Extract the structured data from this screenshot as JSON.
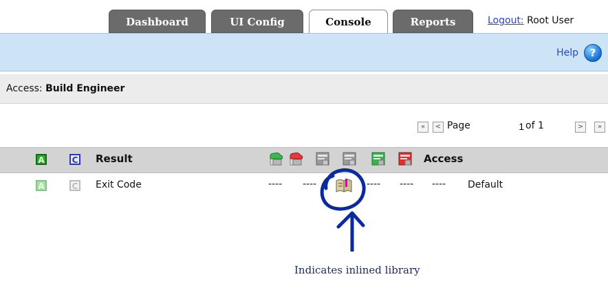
{
  "tabs": [
    {
      "label": "Dashboard"
    },
    {
      "label": "UI Config"
    },
    {
      "label": "Console"
    },
    {
      "label": "Reports"
    }
  ],
  "user": {
    "logout_label": "Logout:",
    "name": "Root User"
  },
  "help_label": "Help",
  "help_icon": "?",
  "access": {
    "prefix": "Access:",
    "role": "Build Engineer"
  },
  "pager": {
    "first_icon": "«",
    "prev_icon": "<",
    "next_icon": ">",
    "last_icon": "»",
    "page_label": "Page",
    "page_value": "1",
    "of_label": "of 1"
  },
  "table": {
    "letters": [
      "A",
      "C"
    ],
    "result_header": "Result",
    "access_header": "Access",
    "header_icons": [
      "green-cloud-icon",
      "red-cloud-icon",
      "gray-form-icon",
      "gray-form-icon",
      "green-form-icon",
      "red-form-icon"
    ],
    "row": {
      "letters": [
        "A",
        "C"
      ],
      "name": "Exit Code",
      "cells": [
        "----",
        "----",
        "----",
        "----",
        "----"
      ],
      "access": "Default"
    }
  },
  "annotation": {
    "text": "Indicates inlined library"
  },
  "colors": {
    "annotation": "#0a2a8a",
    "tab_bg": "#6b6b6b",
    "blue_bar": "#cde3f6"
  }
}
